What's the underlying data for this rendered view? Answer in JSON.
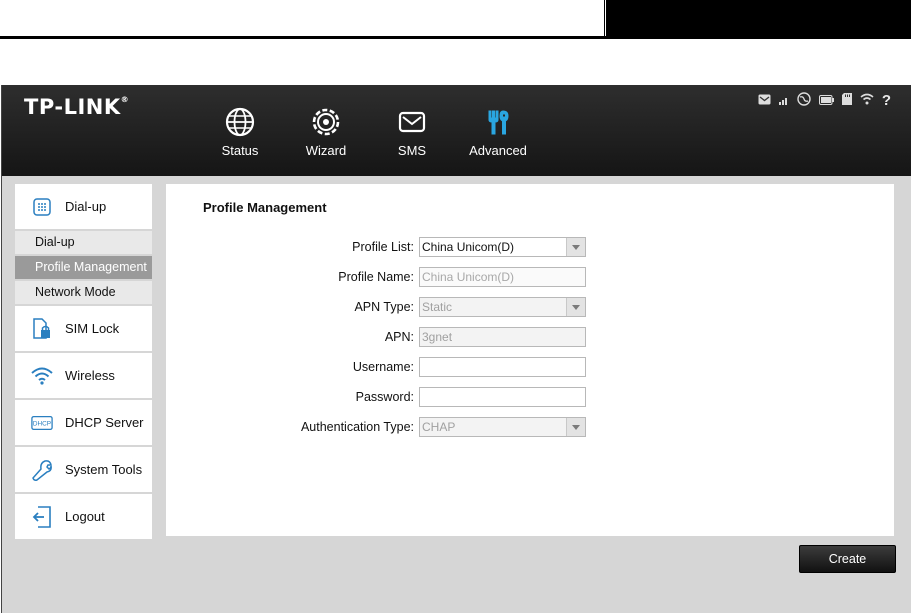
{
  "brand": {
    "logo": "TP-LINK",
    "reg": "®"
  },
  "nav": [
    {
      "label": "Status",
      "icon": "globe-icon"
    },
    {
      "label": "Wizard",
      "icon": "wizard-gear-icon"
    },
    {
      "label": "SMS",
      "icon": "envelope-icon"
    },
    {
      "label": "Advanced",
      "icon": "tools-icon",
      "active": true
    }
  ],
  "status_icons": [
    "message-icon",
    "signal-icon",
    "internet-globe-icon",
    "battery-icon",
    "sd-card-icon",
    "wifi-icon",
    "help-icon"
  ],
  "help_glyph": "?",
  "sidebar": {
    "dialup": "Dial-up",
    "sub_items": [
      "Dial-up",
      "Profile Management",
      "Network Mode"
    ],
    "active_sub": "Profile Management",
    "sim_lock": "SIM Lock",
    "wireless": "Wireless",
    "dhcp": "DHCP Server",
    "dhcp_icon_text": "DHCP",
    "system_tools": "System Tools",
    "logout": "Logout"
  },
  "panel": {
    "title": "Profile Management",
    "fields": {
      "profile_list": {
        "label": "Profile List:",
        "value": "China Unicom(D)"
      },
      "profile_name": {
        "label": "Profile Name:",
        "value": "China Unicom(D)"
      },
      "apn_type": {
        "label": "APN Type:",
        "value": "Static"
      },
      "apn": {
        "label": "APN:",
        "value": "3gnet"
      },
      "username": {
        "label": "Username:",
        "value": ""
      },
      "password": {
        "label": "Password:",
        "value": ""
      },
      "auth_type": {
        "label": "Authentication Type:",
        "value": "CHAP"
      }
    }
  },
  "create_label": "Create",
  "colors": {
    "accent": "#2aa6e0",
    "topbar": "#1e1e1e",
    "frame_bg": "#d6d6d6",
    "active_sub": "#9a9a9a"
  }
}
